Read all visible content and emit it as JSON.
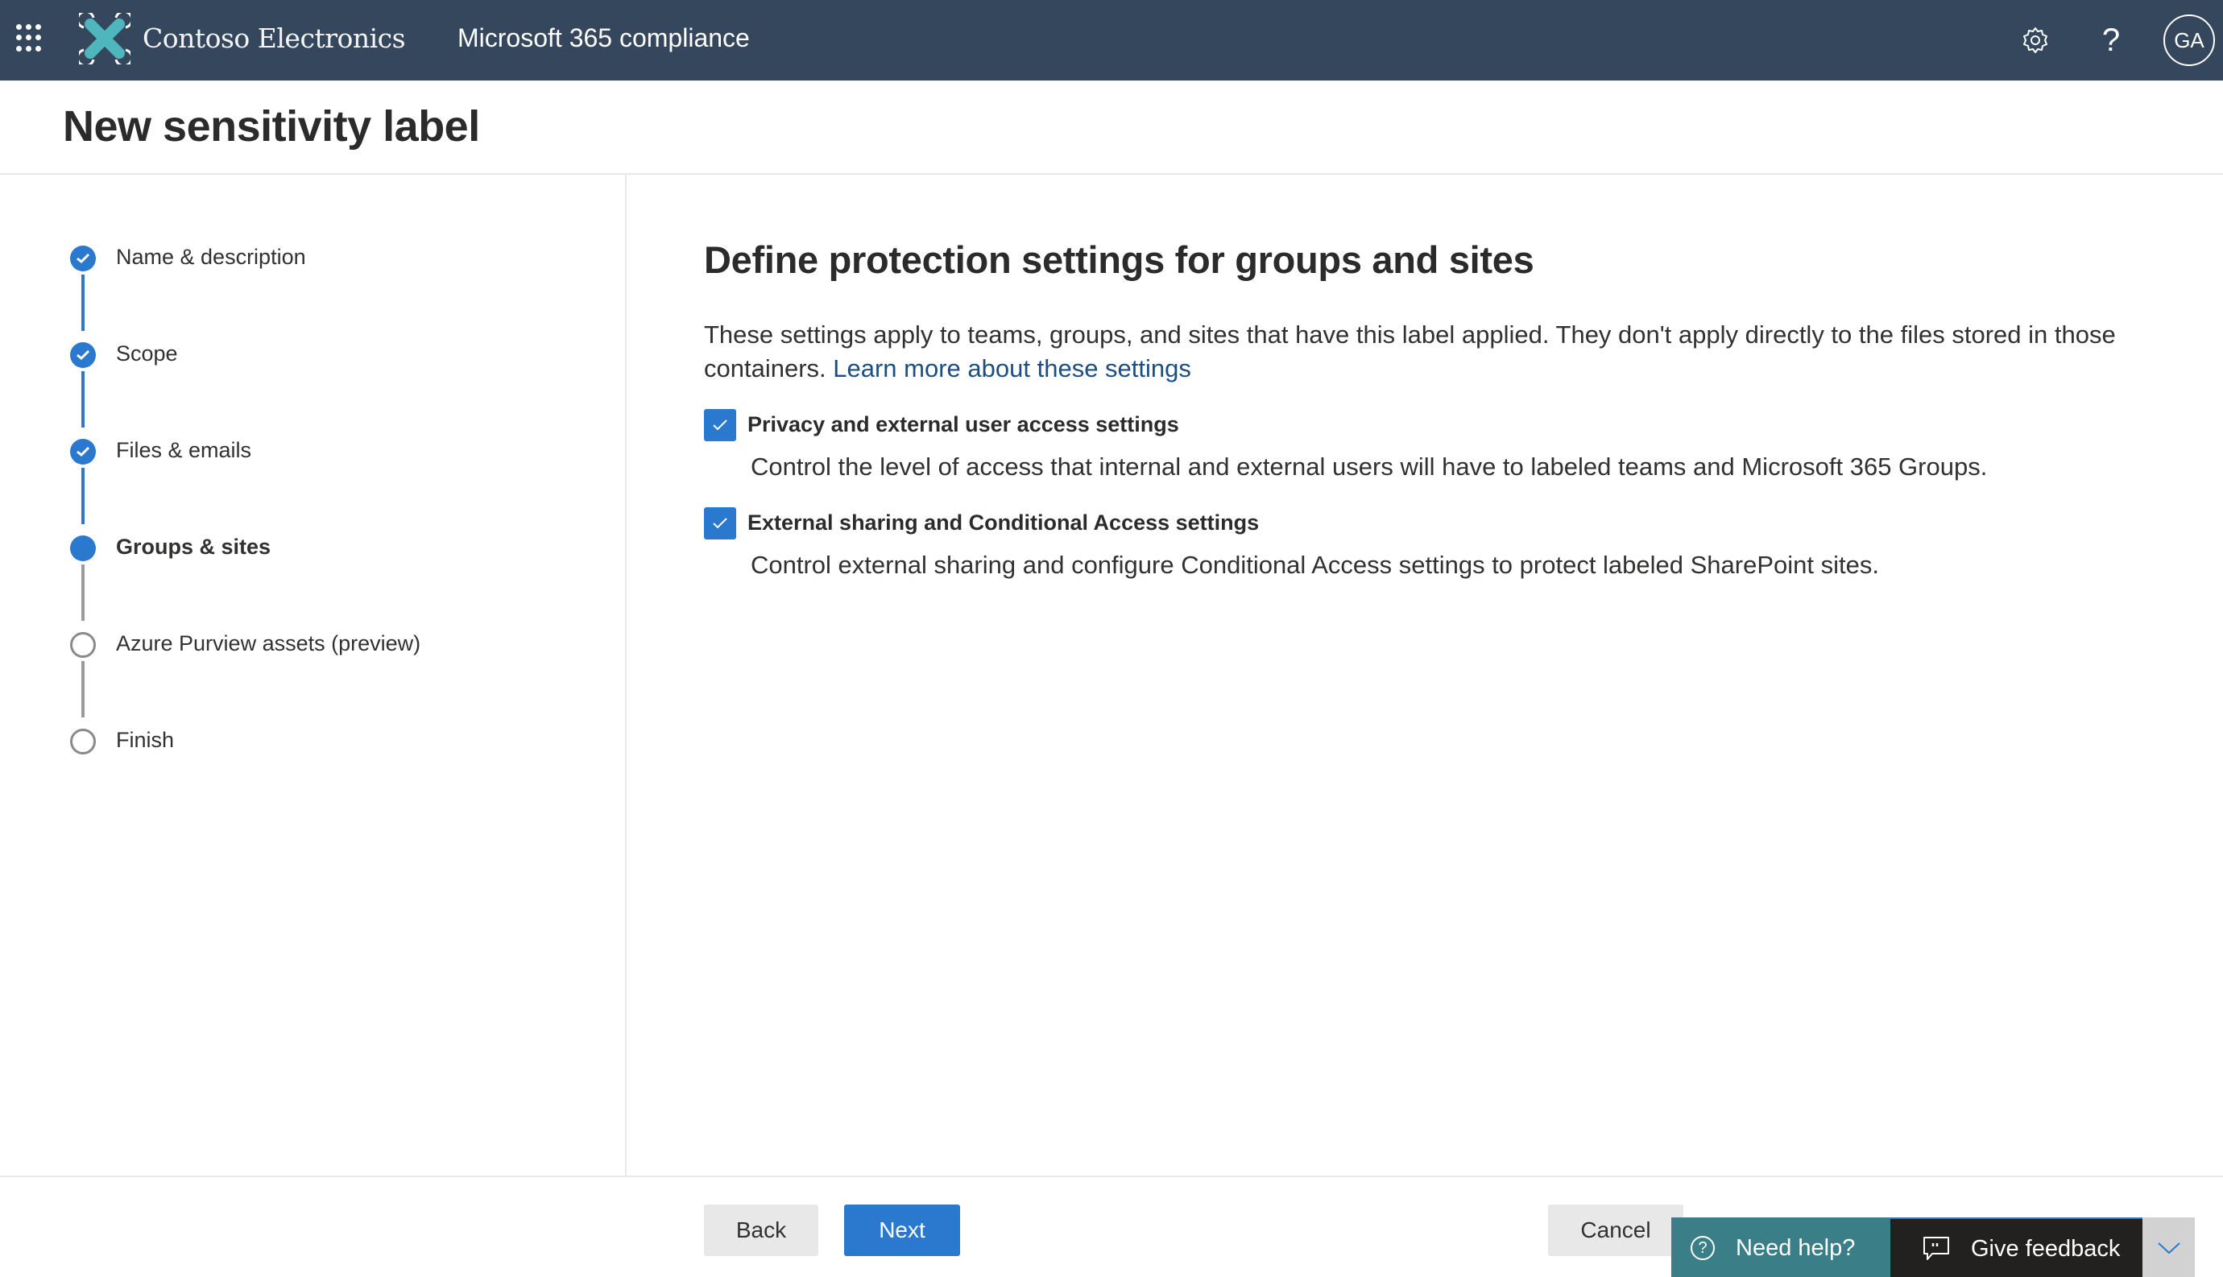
{
  "header": {
    "brand": "Contoso Electronics",
    "app_name": "Microsoft 365 compliance",
    "avatar_initials": "GA",
    "icons": [
      "app-launcher-icon",
      "contoso-logo-icon",
      "settings-gear-icon",
      "help-question-icon"
    ]
  },
  "page": {
    "title": "New sensitivity label"
  },
  "wizard": {
    "steps": [
      {
        "label": "Name & description",
        "status": "completed"
      },
      {
        "label": "Scope",
        "status": "completed"
      },
      {
        "label": "Files & emails",
        "status": "completed"
      },
      {
        "label": "Groups & sites",
        "status": "current"
      },
      {
        "label": "Azure Purview assets (preview)",
        "status": "not-started"
      },
      {
        "label": "Finish",
        "status": "not-started"
      }
    ]
  },
  "main": {
    "heading": "Define protection settings for groups and sites",
    "description": "These settings apply to teams, groups, and sites that have this label applied. They don't apply directly to the files stored in those containers.",
    "learn_more_link": "Learn more about these settings",
    "options": [
      {
        "label": "Privacy and external user access settings",
        "description": "Control the level of access that internal and external users will have to labeled teams and Microsoft 365 Groups.",
        "checked": true
      },
      {
        "label": "External sharing and Conditional Access settings",
        "description": "Control external sharing and configure Conditional Access settings to protect labeled SharePoint sites.",
        "checked": true
      }
    ]
  },
  "footer": {
    "back_label": "Back",
    "next_label": "Next",
    "cancel_label": "Cancel",
    "need_help_label": "Need help?",
    "give_feedback_label": "Give feedback"
  },
  "colors": {
    "header_bg": "#35475d",
    "accent": "#2b79cf",
    "link": "#1d4e82",
    "need_help_bg": "#3a7f87",
    "feedback_bg": "#222120"
  }
}
